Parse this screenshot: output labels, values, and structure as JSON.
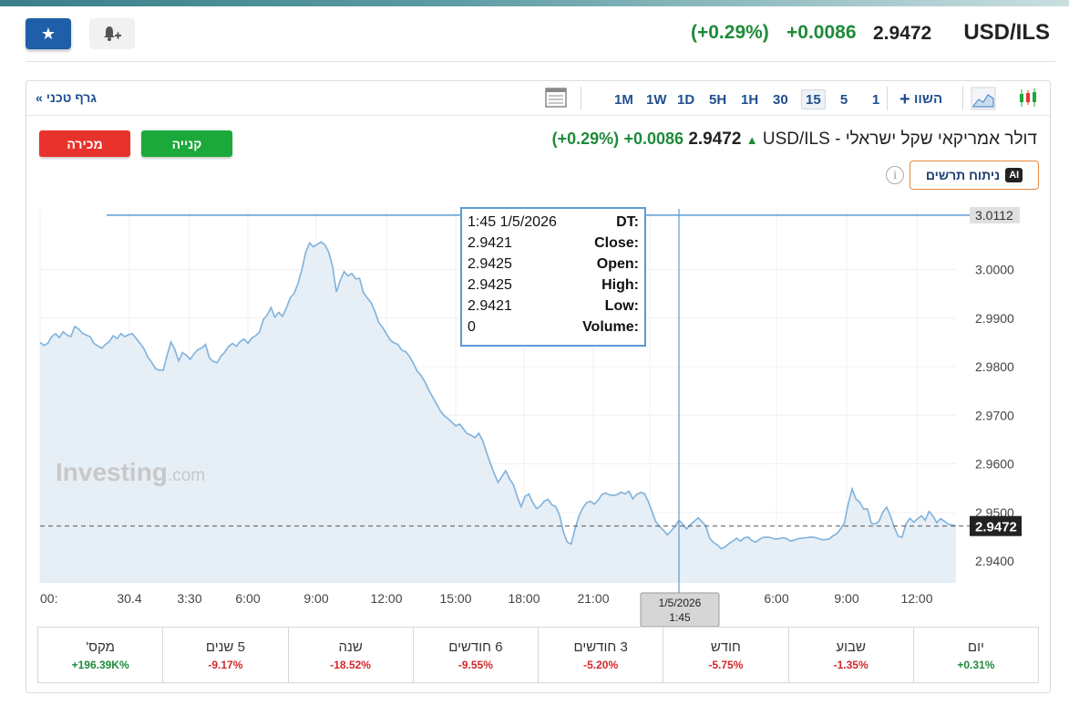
{
  "header": {
    "symbol": "USD/ILS",
    "price": "2.9472",
    "change": "+0.0086",
    "change_pct": "(+0.29%)"
  },
  "toolbar": {
    "tech_chart_label": "גרף טכני",
    "tech_chart_chevron": "»",
    "timeframes": [
      "1M",
      "1W",
      "1D",
      "5H",
      "1H",
      "30",
      "15",
      "5",
      "1"
    ],
    "active_timeframe": "15",
    "compare_label": "השוו"
  },
  "instrument": {
    "title": "USD/ILS - דולר אמריקאי שקל ישראלי",
    "price": "2.9472",
    "change": "+0.0086",
    "change_pct": "(+0.29%)",
    "buy_label": "קנייה",
    "sell_label": "מכירה",
    "ai_label": "ניתוח תרשים",
    "ai_badge": "AI",
    "info_glyph": "i"
  },
  "tooltip": {
    "rows": [
      {
        "key": "DT:",
        "value": "1:45 1/5/2026"
      },
      {
        "key": "Close:",
        "value": "2.9421"
      },
      {
        "key": "Open:",
        "value": "2.9425"
      },
      {
        "key": "High:",
        "value": "2.9425"
      },
      {
        "key": "Low:",
        "value": "2.9421"
      },
      {
        "key": "Volume:",
        "value": "0"
      }
    ]
  },
  "crosshair_label": {
    "date": "1/5/2026",
    "time": "1:45"
  },
  "watermark": {
    "brand": "Investing",
    "suffix": ".com"
  },
  "colors": {
    "line": "#7fb2dc",
    "fill": "#e6eef6",
    "positive": "#1e8a3a",
    "negative": "#d0282c",
    "accent": "#1f5ea8"
  },
  "chart_data": {
    "type": "area",
    "ylim": [
      2.9355,
      3.0125
    ],
    "yticks": [
      "2.9400",
      "2.9500",
      "2.9600",
      "2.9700",
      "2.9800",
      "2.9900",
      "3.0000"
    ],
    "ytop_label": "3.0112",
    "ytop_value": 3.0112,
    "current_label": "2.9472",
    "current_value": 2.9472,
    "xticks": [
      "00:",
      "30.4",
      "3:30",
      "6:00",
      "9:00",
      "12:00",
      "15:00",
      "18:00",
      "21:00",
      "0:",
      "6:00",
      "9:00",
      "12:00"
    ],
    "values": [
      2.985,
      2.9844,
      2.9848,
      2.9862,
      2.9868,
      2.986,
      2.9872,
      2.9865,
      2.9862,
      2.9883,
      2.9878,
      2.9869,
      2.9865,
      2.9862,
      2.9848,
      2.9843,
      2.9838,
      2.9846,
      2.9852,
      2.9864,
      2.9858,
      2.9868,
      2.9862,
      2.9866,
      2.9868,
      2.9858,
      2.9848,
      2.9837,
      2.982,
      2.9809,
      2.9796,
      2.9793,
      2.9793,
      2.9823,
      2.9851,
      2.9836,
      2.9812,
      2.9829,
      2.9824,
      2.9815,
      2.9827,
      2.9835,
      2.9839,
      2.9846,
      2.9818,
      2.9811,
      2.9808,
      2.9822,
      2.983,
      2.9842,
      2.9848,
      2.9842,
      2.9852,
      2.9857,
      2.9848,
      2.9859,
      2.9864,
      2.9871,
      2.9897,
      2.9906,
      2.9922,
      2.9902,
      2.9912,
      2.9904,
      2.9921,
      2.9942,
      2.9951,
      2.9971,
      2.9999,
      3.0035,
      3.0055,
      3.0047,
      3.0052,
      3.0057,
      3.0051,
      3.0036,
      3.0007,
      2.9954,
      2.9978,
      2.9996,
      2.9987,
      2.9992,
      2.9981,
      2.9982,
      2.9953,
      2.9942,
      2.9932,
      2.9914,
      2.9891,
      2.9881,
      2.9868,
      2.9855,
      2.9849,
      2.9846,
      2.9834,
      2.9831,
      2.9821,
      2.9807,
      2.9791,
      2.9782,
      2.9769,
      2.9752,
      2.9738,
      2.9724,
      2.9709,
      2.9699,
      2.9693,
      2.9686,
      2.9678,
      2.9682,
      2.9672,
      2.9662,
      2.9659,
      2.9654,
      2.9663,
      2.9648,
      2.9624,
      2.9601,
      2.958,
      2.9562,
      2.9574,
      2.9586,
      2.9569,
      2.9557,
      2.9532,
      2.9512,
      2.9533,
      2.9538,
      2.9521,
      2.9508,
      2.9513,
      2.9523,
      2.9527,
      2.9516,
      2.9512,
      2.9494,
      2.9459,
      2.9439,
      2.9435,
      2.9466,
      2.9492,
      2.9509,
      2.952,
      2.9523,
      2.9517,
      2.9525,
      2.9537,
      2.954,
      2.9536,
      2.9535,
      2.9537,
      2.9542,
      2.9538,
      2.9544,
      2.9528,
      2.9537,
      2.9541,
      2.9539,
      2.9523,
      2.9502,
      2.9481,
      2.9471,
      2.9463,
      2.9454,
      2.9462,
      2.9471,
      2.9484,
      2.9476,
      2.9466,
      2.9475,
      2.9482,
      2.9489,
      2.9481,
      2.9472,
      2.9447,
      2.9438,
      2.9433,
      2.9425,
      2.9429,
      2.9436,
      2.9441,
      2.9447,
      2.9441,
      2.9448,
      2.9449,
      2.9442,
      2.9439,
      2.9445,
      2.9449,
      2.9449,
      2.9448,
      2.9445,
      2.9446,
      2.9448,
      2.9446,
      2.9441,
      2.9443,
      2.9446,
      2.9447,
      2.9448,
      2.9449,
      2.9449,
      2.9447,
      2.9444,
      2.9444,
      2.9445,
      2.9452,
      2.9456,
      2.9466,
      2.9478,
      2.9518,
      2.9548,
      2.9528,
      2.9521,
      2.9507,
      2.9507,
      2.9478,
      2.9476,
      2.9482,
      2.9501,
      2.9511,
      2.9492,
      2.9469,
      2.9451,
      2.9449,
      2.9476,
      2.9488,
      2.948,
      2.9487,
      2.9493,
      2.9484,
      2.9502,
      2.9493,
      2.9479,
      2.9487,
      2.9482,
      2.9476,
      2.9474,
      2.9472
    ]
  },
  "periods": [
    {
      "label": "יום",
      "value": "+0.31%",
      "sign": "pos"
    },
    {
      "label": "שבוע",
      "value": "-1.35%",
      "sign": "neg"
    },
    {
      "label": "חודש",
      "value": "-5.75%",
      "sign": "neg"
    },
    {
      "label": "3 חודשים",
      "value": "-5.20%",
      "sign": "neg"
    },
    {
      "label": "6 חודשים",
      "value": "-9.55%",
      "sign": "neg"
    },
    {
      "label": "שנה",
      "value": "-18.52%",
      "sign": "neg"
    },
    {
      "label": "5 שנים",
      "value": "-9.17%",
      "sign": "neg"
    },
    {
      "label": "מקס'",
      "value": "+196.39K%",
      "sign": "pos"
    }
  ]
}
